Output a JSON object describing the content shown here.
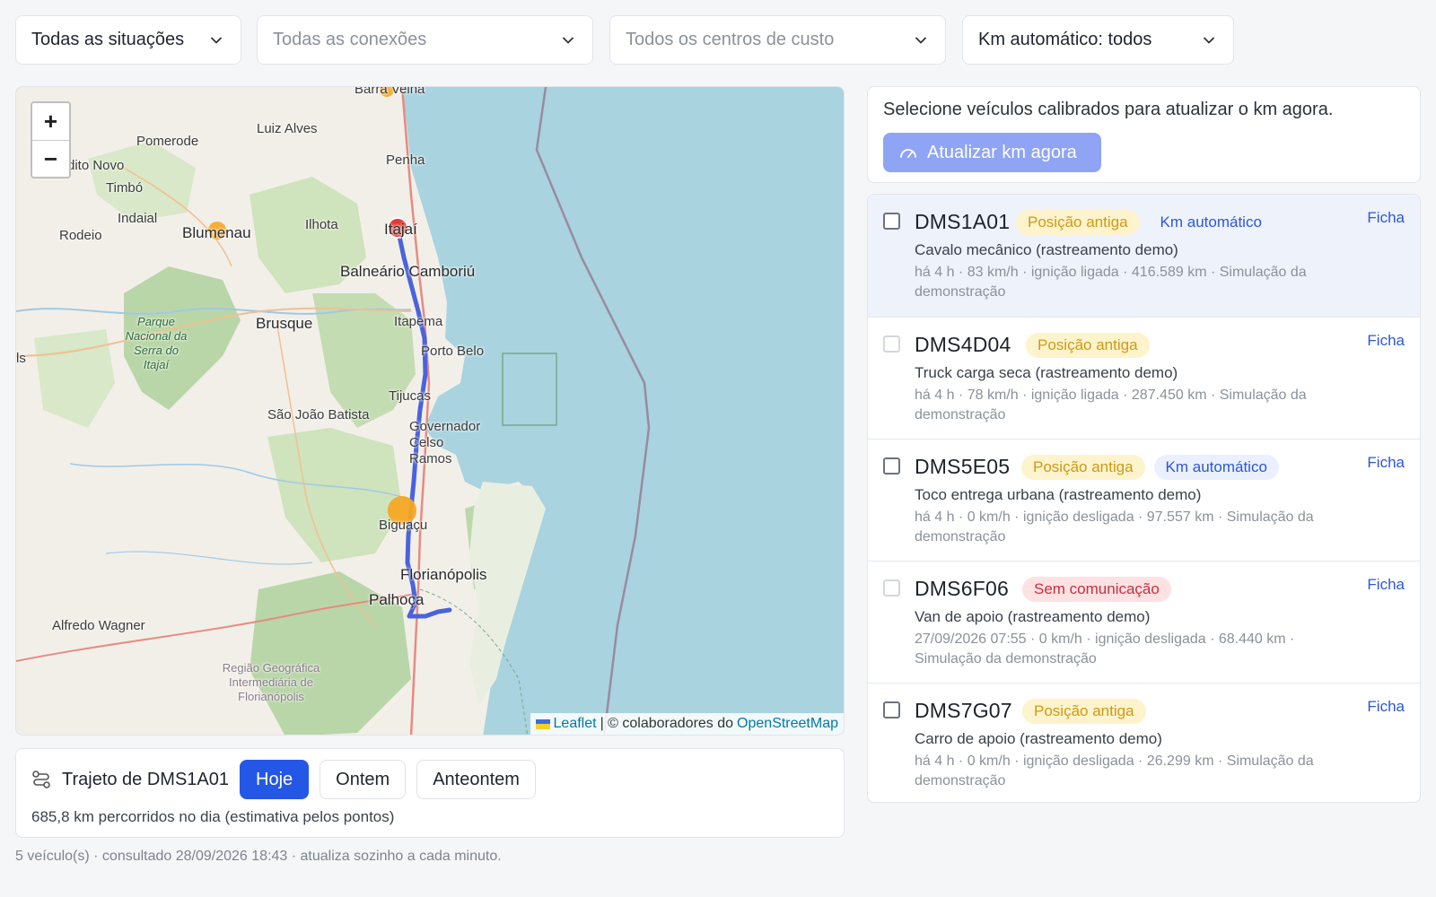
{
  "filters": {
    "situacoes": "Todas as situações",
    "conexoes": "Todas as conexões",
    "centros": "Todos os centros de custo",
    "km": "Km automático: todos"
  },
  "map": {
    "zoom_in": "+",
    "zoom_out": "−",
    "attribution": {
      "leaflet": "Leaflet",
      "separator": "| © colaboradores do",
      "osm": "OpenStreetMap"
    },
    "labels": {
      "barra_velha": "Barra Velha",
      "luiz_alves": "Luiz Alves",
      "pomerode": "Pomerode",
      "benedito_novo": "dito Novo",
      "penha": "Penha",
      "timbo": "Timbó",
      "indaial": "Indaial",
      "rodeio": "Rodeio",
      "blumenau": "Blumenau",
      "ilhota": "Ilhota",
      "itajai": "Itajaí",
      "balneario": "Balneário Camboriú",
      "brusque": "Brusque",
      "itapema": "Itapema",
      "porto_belo": "Porto Belo",
      "parque": "Parque Nacional da Serra do Itajaí",
      "ls": "ls",
      "tijucas": "Tijucas",
      "sao_joao": "São João Batista",
      "governador": "Governador Celso Ramos",
      "biguacu": "Biguaçu",
      "florianopolis": "Florianópolis",
      "palhoca": "Palhoça",
      "alfredo": "Alfredo Wagner",
      "regiao": "Região Geográfica Intermediária de Florianópolis"
    },
    "colors": {
      "route": "#4a63dc",
      "marker_current": "#e53935",
      "marker_stop": "#f5a623"
    }
  },
  "trajeto": {
    "title": "Trajeto de DMS1A01",
    "buttons": [
      "Hoje",
      "Ontem",
      "Anteontem"
    ],
    "active": "Hoje",
    "summary": "685,8 km percorridos no dia (estimativa pelos pontos)"
  },
  "footer": "5 veículo(s) · consultado 28/09/2026 18:43 · atualiza sozinho a cada minuto.",
  "calib": {
    "text": "Selecione veículos calibrados para atualizar o km agora.",
    "button": "Atualizar km agora"
  },
  "ficha_label": "Ficha",
  "vehicles": [
    {
      "plate": "DMS1A01",
      "status": "Posição antiga",
      "km": "Km automático",
      "desc": "Cavalo mecânico (rastreamento demo)",
      "meta": "há 4 h · 83 km/h · ignição ligada · 416.589 km · Simulação da demonstração"
    },
    {
      "plate": "DMS4D04",
      "status": "Posição antiga",
      "km": "",
      "desc": "Truck carga seca (rastreamento demo)",
      "meta": "há 4 h · 78 km/h · ignição ligada · 287.450 km · Simulação da demonstração"
    },
    {
      "plate": "DMS5E05",
      "status": "Posição antiga",
      "km": "Km automático",
      "desc": "Toco entrega urbana (rastreamento demo)",
      "meta": "há 4 h · 0 km/h · ignição desligada · 97.557 km · Simulação da demonstração"
    },
    {
      "plate": "DMS6F06",
      "status": "Sem comunicação",
      "km": "",
      "desc": "Van de apoio (rastreamento demo)",
      "meta": "27/09/2026 07:55 · 0 km/h · ignição desligada · 68.440 km · Simulação da demonstração"
    },
    {
      "plate": "DMS7G07",
      "status": "Posição antiga",
      "km": "",
      "desc": "Carro de apoio (rastreamento demo)",
      "meta": "há 4 h · 0 km/h · ignição desligada · 26.299 km · Simulação da demonstração"
    }
  ]
}
